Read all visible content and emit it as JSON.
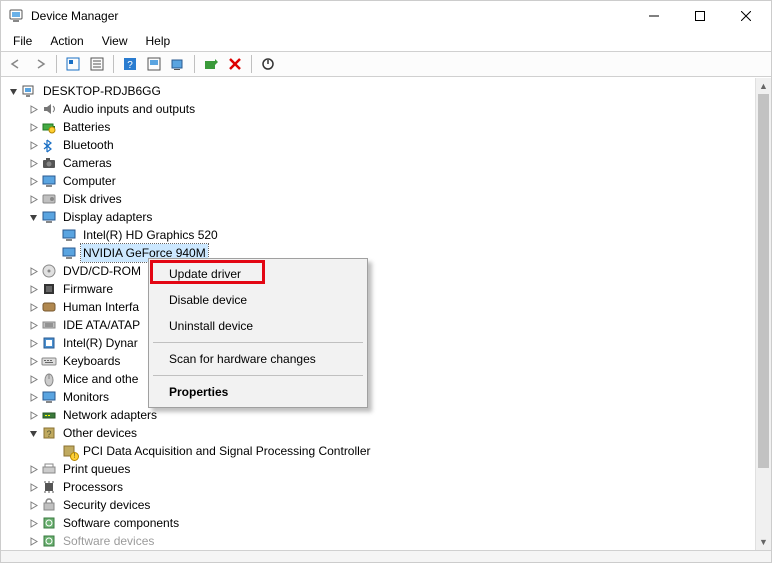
{
  "window": {
    "title": "Device Manager"
  },
  "menubar": [
    "File",
    "Action",
    "View",
    "Help"
  ],
  "toolbar_icons": [
    "back",
    "forward",
    "sep",
    "show-hidden",
    "properties",
    "sep",
    "help",
    "update",
    "monitor",
    "sep",
    "scan",
    "uninstall",
    "sep",
    "enable"
  ],
  "root": {
    "label": "DESKTOP-RDJB6GG"
  },
  "categories": [
    {
      "key": "audio",
      "label": "Audio inputs and outputs",
      "exp": ">"
    },
    {
      "key": "batteries",
      "label": "Batteries",
      "exp": ">"
    },
    {
      "key": "bluetooth",
      "label": "Bluetooth",
      "exp": ">"
    },
    {
      "key": "cameras",
      "label": "Cameras",
      "exp": ">"
    },
    {
      "key": "computer",
      "label": "Computer",
      "exp": ">"
    },
    {
      "key": "disk",
      "label": "Disk drives",
      "exp": ">"
    },
    {
      "key": "display",
      "label": "Display adapters",
      "exp": "v",
      "children": [
        {
          "label": "Intel(R) HD Graphics 520"
        },
        {
          "label": "NVIDIA GeForce 940M",
          "selected": true
        }
      ]
    },
    {
      "key": "dvd",
      "label": "DVD/CD-ROM",
      "exp": ">",
      "truncated": true
    },
    {
      "key": "firmware",
      "label": "Firmware",
      "exp": ">"
    },
    {
      "key": "hid",
      "label": "Human Interfa",
      "exp": ">",
      "truncated": true
    },
    {
      "key": "ide",
      "label": "IDE ATA/ATAP",
      "exp": ">",
      "truncated": true
    },
    {
      "key": "dynamic",
      "label": "Intel(R) Dynar",
      "exp": ">",
      "truncated": true
    },
    {
      "key": "keyboards",
      "label": "Keyboards",
      "exp": ">"
    },
    {
      "key": "mice",
      "label": "Mice and othe",
      "exp": ">",
      "truncated": true
    },
    {
      "key": "monitors",
      "label": "Monitors",
      "exp": ">"
    },
    {
      "key": "network",
      "label": "Network adapters",
      "exp": ">"
    },
    {
      "key": "other",
      "label": "Other devices",
      "exp": "v",
      "children": [
        {
          "label": "PCI Data Acquisition and Signal Processing Controller",
          "warn": true
        }
      ]
    },
    {
      "key": "printq",
      "label": "Print queues",
      "exp": ">"
    },
    {
      "key": "processors",
      "label": "Processors",
      "exp": ">"
    },
    {
      "key": "security",
      "label": "Security devices",
      "exp": ">"
    },
    {
      "key": "softcomp",
      "label": "Software components",
      "exp": ">"
    },
    {
      "key": "softdev",
      "label": "Software devices",
      "exp": ">",
      "faded": true
    }
  ],
  "context_menu": {
    "items": [
      {
        "label": "Update driver",
        "key": "update"
      },
      {
        "label": "Disable device",
        "key": "disable"
      },
      {
        "label": "Uninstall device",
        "key": "uninstall"
      },
      {
        "sep": true
      },
      {
        "label": "Scan for hardware changes",
        "key": "scan"
      },
      {
        "sep": true
      },
      {
        "label": "Properties",
        "key": "properties",
        "bold": true
      }
    ]
  }
}
